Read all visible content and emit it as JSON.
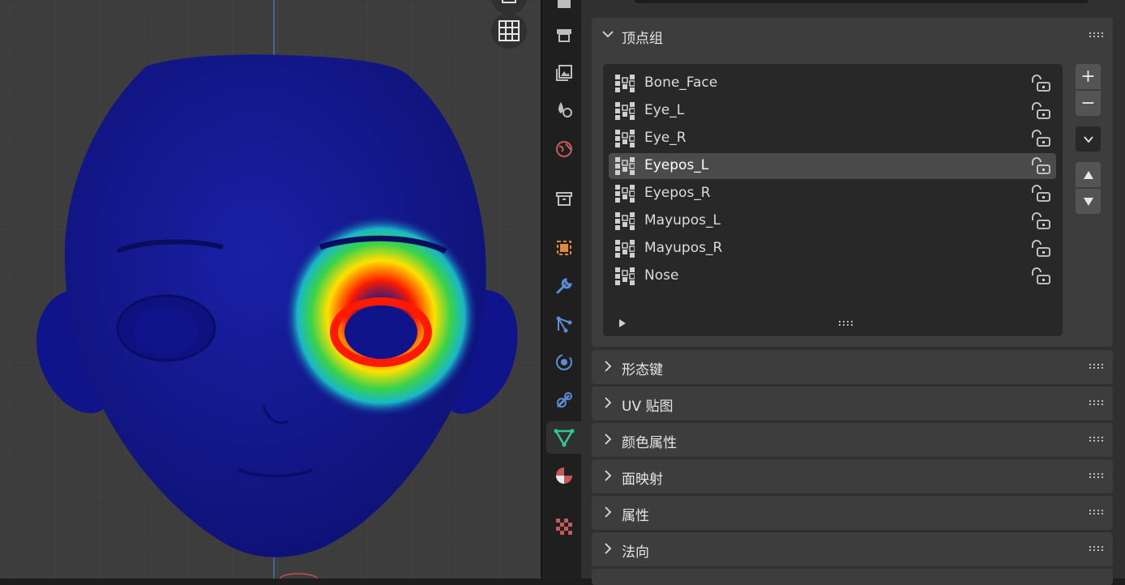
{
  "viewport": {
    "buttons": [
      {
        "icon": "grid-icon"
      }
    ]
  },
  "tabs": [
    {
      "id": "render",
      "icon": "printer-icon",
      "active": false
    },
    {
      "id": "output",
      "icon": "image-output-icon",
      "active": false
    },
    {
      "id": "view-layer",
      "icon": "view-layer-icon",
      "active": false
    },
    {
      "id": "scene",
      "icon": "scene-icon",
      "active": false
    },
    {
      "id": "world",
      "icon": "world-icon",
      "active": false
    },
    {
      "id": "collection",
      "icon": "collection-box-icon",
      "active": false
    },
    {
      "id": "object",
      "icon": "object-square-icon",
      "active": false
    },
    {
      "id": "modifiers",
      "icon": "wrench-icon",
      "active": false
    },
    {
      "id": "particles",
      "icon": "particles-icon",
      "active": false
    },
    {
      "id": "physics",
      "icon": "physics-orbit-icon",
      "active": false
    },
    {
      "id": "constraints",
      "icon": "constraint-icon",
      "active": false
    },
    {
      "id": "data",
      "icon": "mesh-data-icon",
      "active": true
    },
    {
      "id": "material",
      "icon": "material-sphere-icon",
      "active": false
    },
    {
      "id": "texture",
      "icon": "checker-texture-icon",
      "active": false
    }
  ],
  "vertex_groups": {
    "title": "顶点组",
    "items": [
      {
        "name": "Bone_Face",
        "selected": false
      },
      {
        "name": "Eye_L",
        "selected": false
      },
      {
        "name": "Eye_R",
        "selected": false
      },
      {
        "name": "Eyepos_L",
        "selected": true
      },
      {
        "name": "Eyepos_R",
        "selected": false
      },
      {
        "name": "Mayupos_L",
        "selected": false
      },
      {
        "name": "Mayupos_R",
        "selected": false
      },
      {
        "name": "Nose",
        "selected": false
      }
    ],
    "buttons": {
      "add": "+",
      "remove": "−"
    }
  },
  "panels": [
    {
      "title": "形态键"
    },
    {
      "title": "UV 贴图"
    },
    {
      "title": "颜色属性"
    },
    {
      "title": "面映射"
    },
    {
      "title": "属性"
    },
    {
      "title": "法向"
    }
  ],
  "colors": {
    "accent_active_tab": "#2ec8a0",
    "mesh_blue": "#12168f",
    "weight_red": "#ff1a00"
  }
}
